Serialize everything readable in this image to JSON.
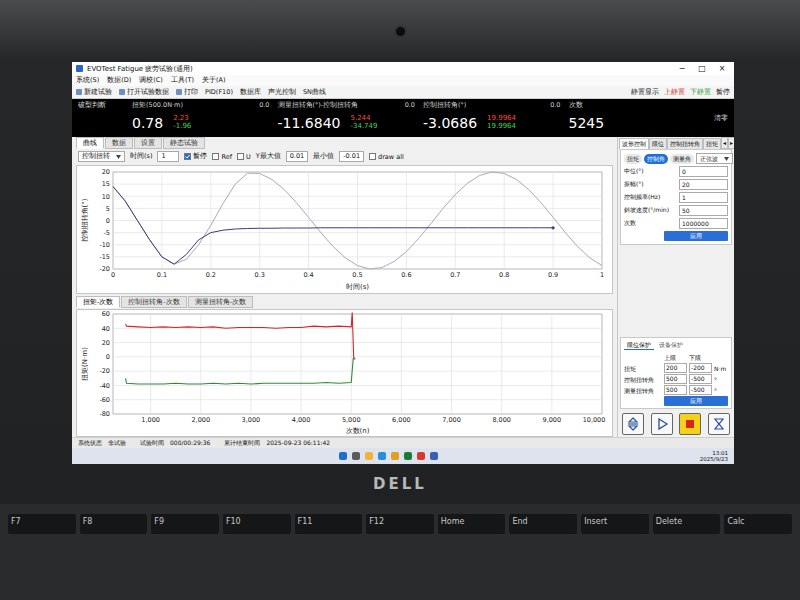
{
  "window": {
    "title": "EVOTest Fatigue 疲劳试验(通用)",
    "controls": [
      "−",
      "□",
      "×"
    ]
  },
  "menu": [
    "系统(S)",
    "数据(D)",
    "调校(C)",
    "工具(T)",
    "关于(A)"
  ],
  "toolbar": {
    "items": [
      "新建试验",
      "打开试验数据",
      "打印",
      "PID(F10)",
      "数据库",
      "声光控制",
      "SN曲线"
    ],
    "indicators": [
      {
        "label": "静置显示",
        "color": "#222222"
      },
      {
        "label": "上静置",
        "color": "#d0342c"
      },
      {
        "label": "下静置",
        "color": "#2e9e3f"
      },
      {
        "label": "暂停",
        "color": "#222222"
      }
    ]
  },
  "readouts": {
    "mode_label": "破型判断",
    "items": [
      {
        "label": "扭矩(500.0N·m)",
        "zero": "0.0",
        "value": "0.78",
        "max": "2.23",
        "min": "-1.96"
      },
      {
        "label": "测量扭转角(°)-控制扭转角",
        "zero": "0.0",
        "value": "-11.6840",
        "max": "5.244",
        "min": "-34.749"
      },
      {
        "label": "控制扭转角(°)",
        "zero": "0.0",
        "value": "-3.0686",
        "max": "19.9964",
        "min": "19.9964"
      },
      {
        "label": "次数",
        "value": "5245"
      }
    ],
    "reset": "清零"
  },
  "left_tabs": [
    {
      "label": "曲线",
      "selected": true
    },
    {
      "label": "数据",
      "selected": false
    },
    {
      "label": "设置",
      "selected": false
    },
    {
      "label": "静态试验",
      "selected": false
    }
  ],
  "curve_controls": {
    "channel": "控制扭转",
    "time_label": "时间(s)",
    "time": "1",
    "checks": [
      {
        "label": "暂停",
        "checked": true
      },
      {
        "label": "Ref",
        "checked": false
      },
      {
        "label": "U",
        "checked": false
      }
    ],
    "ymax_label": "Y最大值",
    "ymax": "0.01",
    "ymin_label": "最小值",
    "ymin": "-0.01",
    "draw_all": {
      "label": "draw all",
      "checked": false
    }
  },
  "time_chart": {
    "y_label": "控制扭转角(°)",
    "x_label": "时间(s)",
    "y_ticks": [
      "20",
      "15",
      "10",
      "5",
      "0",
      "-5",
      "-10",
      "-15",
      "-20"
    ],
    "x_ticks": [
      "0",
      "0.1",
      "0.2",
      "0.3",
      "0.4",
      "0.5",
      "0.6",
      "0.7",
      "0.8",
      "0.9",
      "1"
    ],
    "x_step": 0.025,
    "series": [
      {
        "color": "#a8aab8",
        "marker": false,
        "values": [
          14,
          8,
          0,
          -8,
          -15,
          -18,
          -16,
          -10,
          -2,
          7,
          15,
          19.5,
          19.4,
          16.9,
          12.8,
          7.4,
          1.3,
          -5,
          -10.7,
          -15.4,
          -18.6,
          -20,
          -19.4,
          -16.9,
          -12.8,
          -7.4,
          -1.3,
          5,
          10.7,
          15.4,
          18.6,
          20,
          19.4,
          16.9,
          12.8,
          7.4,
          1.3,
          -5,
          -10.7,
          -15.4,
          -18.6
        ]
      },
      {
        "color": "#3b3f78",
        "marker": true,
        "values": [
          14,
          8,
          0,
          -8,
          -15,
          -18,
          -14,
          -8,
          -5,
          -4,
          -3.5,
          -3.3,
          -3.2,
          -3.2,
          -3.1,
          -3.1,
          -3.1,
          -3,
          -3,
          -3,
          -3,
          -3,
          -3,
          -3,
          -3,
          -3,
          -3,
          -3,
          -3,
          -3,
          -3,
          -3,
          -3,
          -3,
          -3,
          -3,
          -3
        ]
      }
    ]
  },
  "count_tabs": [
    {
      "label": "扭矩-次数",
      "selected": true
    },
    {
      "label": "控制扭转角-次数",
      "selected": false
    },
    {
      "label": "测量扭转角-次数",
      "selected": false
    }
  ],
  "count_chart": {
    "y_label": "扭矩(N·m)",
    "x_label": "次数(n)",
    "y_ticks": [
      "60",
      "40",
      "20",
      "0",
      "-20",
      "-40",
      "-60",
      "-80"
    ],
    "x_ticks": [
      "1,000",
      "2,000",
      "3,000",
      "4,000",
      "5,000",
      "6,000",
      "7,000",
      "8,000",
      "9,000",
      "10,000"
    ],
    "x_range": [
      250,
      10000
    ],
    "series": [
      {
        "color": "#cc2a2a",
        "points": [
          [
            500,
            46
          ],
          [
            520,
            43
          ],
          [
            750,
            42
          ],
          [
            1000,
            41
          ],
          [
            1250,
            42
          ],
          [
            1500,
            41
          ],
          [
            1750,
            42
          ],
          [
            2000,
            41
          ],
          [
            2250,
            42
          ],
          [
            2500,
            40
          ],
          [
            2750,
            41
          ],
          [
            3000,
            41
          ],
          [
            3250,
            41
          ],
          [
            3500,
            40
          ],
          [
            3750,
            41
          ],
          [
            4000,
            41
          ],
          [
            4250,
            43
          ],
          [
            4500,
            42
          ],
          [
            4750,
            43
          ],
          [
            5000,
            42
          ],
          [
            5020,
            62
          ],
          [
            5050,
            -3
          ],
          [
            5080,
            -3
          ]
        ]
      },
      {
        "color": "#2e8b3a",
        "points": [
          [
            500,
            -30
          ],
          [
            520,
            -37
          ],
          [
            750,
            -38
          ],
          [
            1000,
            -38
          ],
          [
            1250,
            -38
          ],
          [
            1500,
            -37
          ],
          [
            1750,
            -38
          ],
          [
            2000,
            -38
          ],
          [
            2250,
            -37
          ],
          [
            2500,
            -38
          ],
          [
            2750,
            -37
          ],
          [
            3000,
            -38
          ],
          [
            3250,
            -37
          ],
          [
            3500,
            -37
          ],
          [
            3750,
            -37
          ],
          [
            4000,
            -37
          ],
          [
            4250,
            -37
          ],
          [
            4500,
            -36
          ],
          [
            4750,
            -37
          ],
          [
            5000,
            -36
          ],
          [
            5040,
            -2
          ],
          [
            5080,
            -2
          ]
        ]
      }
    ]
  },
  "wave_panel": {
    "tabs": [
      {
        "label": "波形控制",
        "selected": true
      },
      {
        "label": "限位",
        "selected": false
      },
      {
        "label": "控制扭转角",
        "selected": false
      },
      {
        "label": "扭矩",
        "selected": false
      }
    ],
    "scroll": [
      "◂",
      "▸"
    ],
    "modes": [
      {
        "label": "扭矩",
        "selected": false
      },
      {
        "label": "控制角",
        "selected": true
      },
      {
        "label": "测量角",
        "selected": false
      }
    ],
    "waveform": "正弦波",
    "fields": [
      {
        "label": "中位(°)",
        "value": "0"
      },
      {
        "label": "振幅(°)",
        "value": "20"
      },
      {
        "label": "控制频率(Hz)",
        "value": "1"
      },
      {
        "label": "斜坡速度(°/min)",
        "value": "50"
      },
      {
        "label": "次数",
        "value": "1000000"
      }
    ],
    "apply": "应用"
  },
  "limits": {
    "tabs": [
      {
        "label": "限位保护",
        "selected": true
      },
      {
        "label": "设备保护",
        "selected": false
      }
    ],
    "headers": [
      "上限",
      "下限"
    ],
    "rows": [
      {
        "name": "扭矩",
        "upper": "200",
        "lower": "-200",
        "unit": "N·m"
      },
      {
        "name": "控制扭转角",
        "upper": "500",
        "lower": "-500",
        "unit": "°"
      },
      {
        "name": "测量扭转角",
        "upper": "500",
        "lower": "-500",
        "unit": "°"
      }
    ],
    "apply": "应用"
  },
  "run_buttons": [
    {
      "kind": "sort",
      "selected": false
    },
    {
      "kind": "play",
      "selected": false
    },
    {
      "kind": "stop",
      "selected": true
    },
    {
      "kind": "hourglass",
      "selected": false
    }
  ],
  "status_bar": [
    {
      "label": "系统状态",
      "value": "非试验"
    },
    {
      "label": "试验时间",
      "value": "000/00:29:36"
    },
    {
      "label": "累计结束时间",
      "value": "2025-09-23 06:11:42"
    }
  ],
  "taskbar": {
    "time": "13:01",
    "date": "2025/9/23"
  },
  "laptop": {
    "logo": "DELL",
    "keys": [
      "F7",
      "F8",
      "F9",
      "F10",
      "F11",
      "F12",
      "Home",
      "End",
      "Insert",
      "Delete",
      "Calc"
    ]
  }
}
